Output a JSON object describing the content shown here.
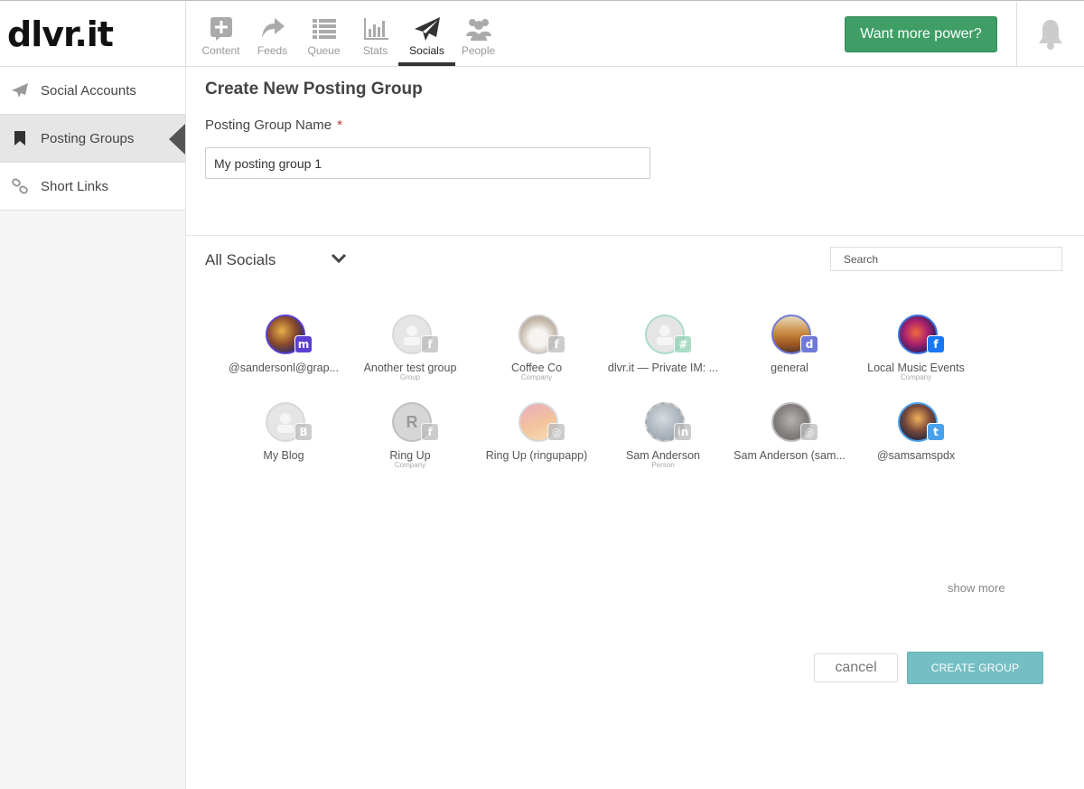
{
  "app": {
    "logo": "dlvr.it"
  },
  "nav": {
    "items": [
      {
        "label": "Content",
        "icon": "plus-box-icon"
      },
      {
        "label": "Feeds",
        "icon": "share-arrow-icon"
      },
      {
        "label": "Queue",
        "icon": "list-icon"
      },
      {
        "label": "Stats",
        "icon": "bar-chart-icon"
      },
      {
        "label": "Socials",
        "icon": "paper-plane-icon",
        "active": true
      },
      {
        "label": "People",
        "icon": "people-icon"
      }
    ],
    "upgrade_label": "Want more power?",
    "upgrade_color": "#3f9e66"
  },
  "sidebar": {
    "items": [
      {
        "label": "Social Accounts",
        "icon": "paper-plane-icon"
      },
      {
        "label": "Posting Groups",
        "icon": "bookmark-icon",
        "active": true
      },
      {
        "label": "Short Links",
        "icon": "link-icon"
      }
    ]
  },
  "form": {
    "title": "Create New Posting Group",
    "name_label": "Posting Group Name",
    "required_mark": "*",
    "name_value": "My posting group 1"
  },
  "socials": {
    "filter_label": "All Socials",
    "search_placeholder": "Search",
    "items": [
      {
        "name": "@sandersonl@grap...",
        "type": "",
        "network": "mastodon-icon"
      },
      {
        "name": "Another test group",
        "type": "Group",
        "network": "facebook-icon"
      },
      {
        "name": "Coffee Co",
        "type": "Company",
        "network": "facebook-icon"
      },
      {
        "name": "dlvr.it — Private IM: ...",
        "type": "",
        "network": "slack-icon"
      },
      {
        "name": "general",
        "type": "",
        "network": "discord-icon"
      },
      {
        "name": "Local Music Events",
        "type": "Company",
        "network": "facebook-icon"
      },
      {
        "name": "My Blog",
        "type": "",
        "network": "blogger-icon"
      },
      {
        "name": "Ring Up",
        "type": "Company",
        "network": "facebook-icon"
      },
      {
        "name": "Ring Up (ringupapp)",
        "type": "",
        "network": "instagram-icon"
      },
      {
        "name": "Sam Anderson",
        "type": "Person",
        "network": "linkedin-icon"
      },
      {
        "name": "Sam Anderson (sam...",
        "type": "",
        "network": "instagram-icon"
      },
      {
        "name": "@samsamspdx",
        "type": "",
        "network": "twitter-icon"
      }
    ],
    "show_more_label": "show more"
  },
  "actions": {
    "cancel_label": "cancel",
    "create_label": "CREATE GROUP",
    "create_color": "#74bfc4"
  }
}
